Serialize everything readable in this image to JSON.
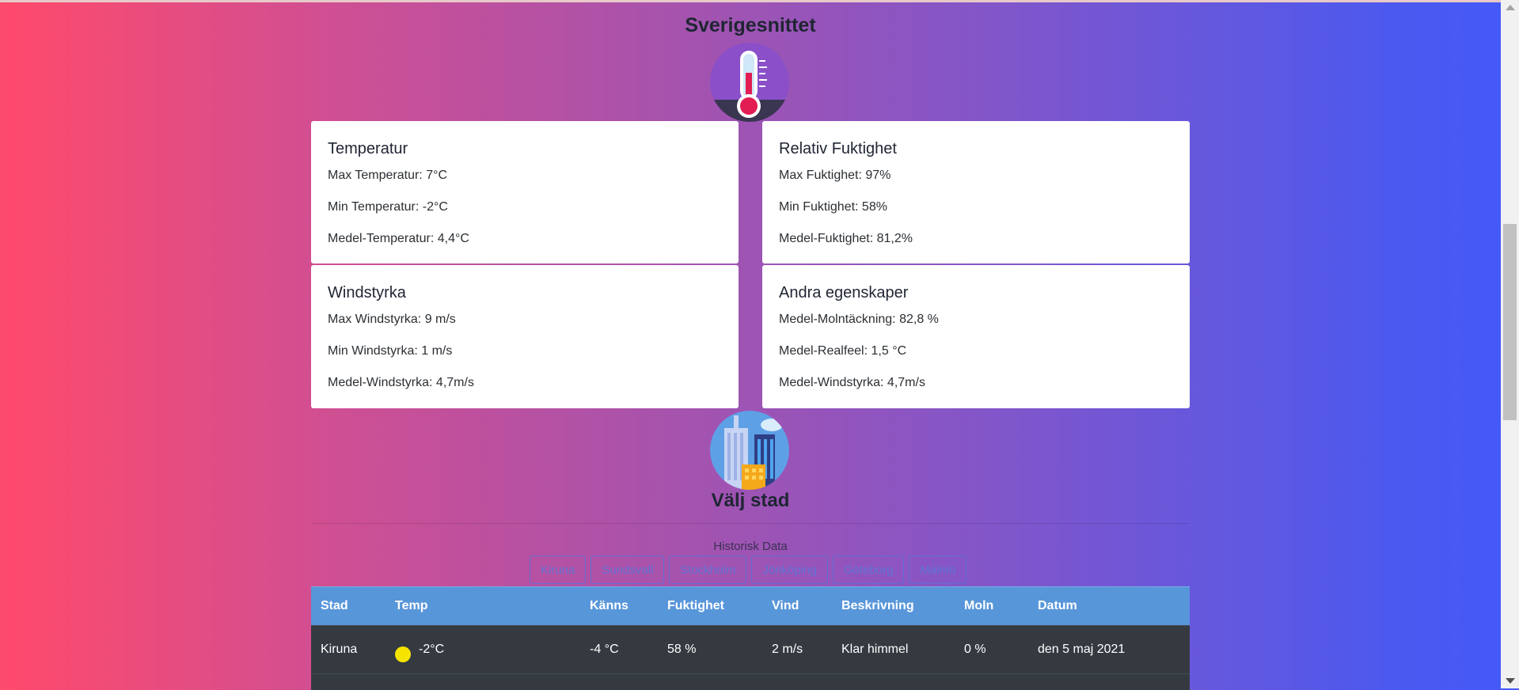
{
  "header": {
    "title": "Sverigesnittet"
  },
  "cards": {
    "temperature": {
      "title": "Temperatur",
      "line1": "Max Temperatur: 7°C",
      "line2": "Min Temperatur: -2°C",
      "line3": "Medel-Temperatur: 4,4°C"
    },
    "humidity": {
      "title": "Relativ Fuktighet",
      "line1": "Max Fuktighet: 97%",
      "line2": "Min Fuktighet: 58%",
      "line3": "Medel-Fuktighet: 81,2%"
    },
    "wind": {
      "title": "Windstyrka",
      "line1": "Max Windstyrka: 9 m/s",
      "line2": "Min Windstyrka: 1 m/s",
      "line3": "Medel-Windstyrka: 4,7m/s"
    },
    "other": {
      "title": "Andra egenskaper",
      "line1": "Medel-Molntäckning: 82,8 %",
      "line2": "Medel-Realfeel: 1,5 °C",
      "line3": "Medel-Windstyrka: 4,7m/s"
    }
  },
  "city_section": {
    "title": "Välj stad",
    "history_label": "Historisk Data",
    "buttons": [
      "Kiruna",
      "Sundsvall",
      "Stockholm",
      "Jönköping",
      "Göteborg",
      "Malmö"
    ]
  },
  "table": {
    "headers": [
      "Stad",
      "Temp",
      "Känns",
      "Fuktighet",
      "Vind",
      "Beskrivning",
      "Moln",
      "Datum"
    ],
    "rows": [
      {
        "stad": "Kiruna",
        "weather_icon": "sun-icon",
        "temp": "-2°C",
        "kanns": "-4 °C",
        "fukt": "58 %",
        "vind": "2 m/s",
        "besk": "Klar himmel",
        "moln": "0 %",
        "datum": "den 5 maj 2021"
      }
    ]
  },
  "icons": {
    "top": "thermometer-icon",
    "middle": "city-buildings-icon"
  },
  "colors": {
    "table_header": "#5896da",
    "table_row": "#343a40",
    "sun": "#f5e400"
  }
}
